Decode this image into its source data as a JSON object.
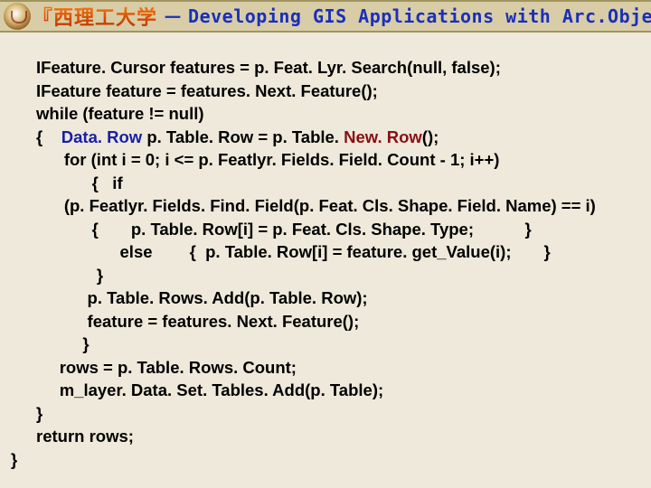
{
  "header": {
    "institution": "『西理工大学",
    "dash": "－",
    "course": "Developing GIS Applications with Arc.Objects using C#. NE"
  },
  "code": {
    "l1a": "IFeature. Cursor ",
    "l1b": "features = p. Feat. Lyr. Search(null, false);",
    "l2a": "IFeature ",
    "l2b": "feature = features. Next. Feature();",
    "l3": "while (feature != null)",
    "l4a": "{    ",
    "l4b": "Data. Row ",
    "l4c": "p. Table. Row = p. Table. ",
    "l4d": "New. Row",
    "l4e": "();",
    "l5": "      for (int i = 0; i <= p. Featlyr. Fields. Field. Count - 1; i++)",
    "l6": "            {   if",
    "l7": "      (p. Featlyr. Fields. Find. Field(p. Feat. Cls. Shape. Field. Name) == i)",
    "l8": "            {       p. Table. Row[i] = p. Feat. Cls. Shape. Type;           }",
    "l9": "                  else        {  p. Table. Row[i] = feature. get_Value(i);       }",
    "l10": "             }",
    "l11": "           p. Table. Rows. Add(p. Table. Row);",
    "l12": "           feature = features. Next. Feature();",
    "l13": "          }",
    "l14": "     rows = p. Table. Rows. Count;",
    "l15": "     m_layer. Data. Set. Tables. Add(p. Table);",
    "l16": "}",
    "l17": "return rows;",
    "end": "}"
  }
}
